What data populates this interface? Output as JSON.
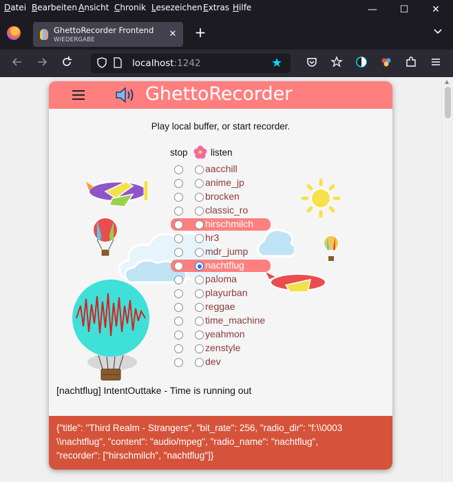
{
  "menubar": {
    "items": [
      "Datei",
      "Bearbeiten",
      "Ansicht",
      "Chronik",
      "Lesezeichen",
      "Extras",
      "Hilfe"
    ]
  },
  "window_controls": {
    "minimize": "—",
    "maximize": "☐",
    "close": "✕"
  },
  "tab": {
    "title": "GhettoRecorder Frontend",
    "subtitle": "WIEDERGABE",
    "close": "✕"
  },
  "newtab": "+",
  "urlbar": {
    "host": "localhost",
    "port": ":1242"
  },
  "app": {
    "title": "GhettoRecorder",
    "subtitle": "Play local buffer, or start recorder.",
    "col_stop": "stop",
    "col_listen": "listen",
    "stations": [
      {
        "name": "aacchill",
        "highlight": false,
        "checked": false
      },
      {
        "name": "anime_jp",
        "highlight": false,
        "checked": false
      },
      {
        "name": "brocken",
        "highlight": false,
        "checked": false
      },
      {
        "name": "classic_ro",
        "highlight": false,
        "checked": false
      },
      {
        "name": "hirschmilch",
        "highlight": true,
        "checked": false
      },
      {
        "name": "hr3",
        "highlight": false,
        "checked": false
      },
      {
        "name": "mdr_jump",
        "highlight": false,
        "checked": false
      },
      {
        "name": "nachtflug",
        "highlight": true,
        "checked": true
      },
      {
        "name": "paloma",
        "highlight": false,
        "checked": false
      },
      {
        "name": "playurban",
        "highlight": false,
        "checked": false
      },
      {
        "name": "reggae",
        "highlight": false,
        "checked": false
      },
      {
        "name": "time_machine",
        "highlight": false,
        "checked": false
      },
      {
        "name": "yeahmon",
        "highlight": false,
        "checked": false
      },
      {
        "name": "zenstyle",
        "highlight": false,
        "checked": false
      },
      {
        "name": "dev",
        "highlight": false,
        "checked": false
      }
    ],
    "now_playing": "[nachtflug] IntentOuttake - Time is running out",
    "json_line1": "{\"title\": \"Third Realm - Strangers\", \"bit_rate\": 256, \"radio_dir\": \"f:\\\\0003",
    "json_line2": "\\\\nachtflug\", \"content\": \"audio/mpeg\", \"radio_name\": \"nachtflug\",",
    "json_line3": "\"recorder\": [\"hirschmilch\", \"nachtflug\"]}"
  },
  "colors": {
    "header": "#ff7f7f",
    "json_bar": "#d5533a",
    "station_text": "#8b3a3a",
    "browser_chrome": "#1c1b22",
    "accent_star": "#00ddff"
  }
}
